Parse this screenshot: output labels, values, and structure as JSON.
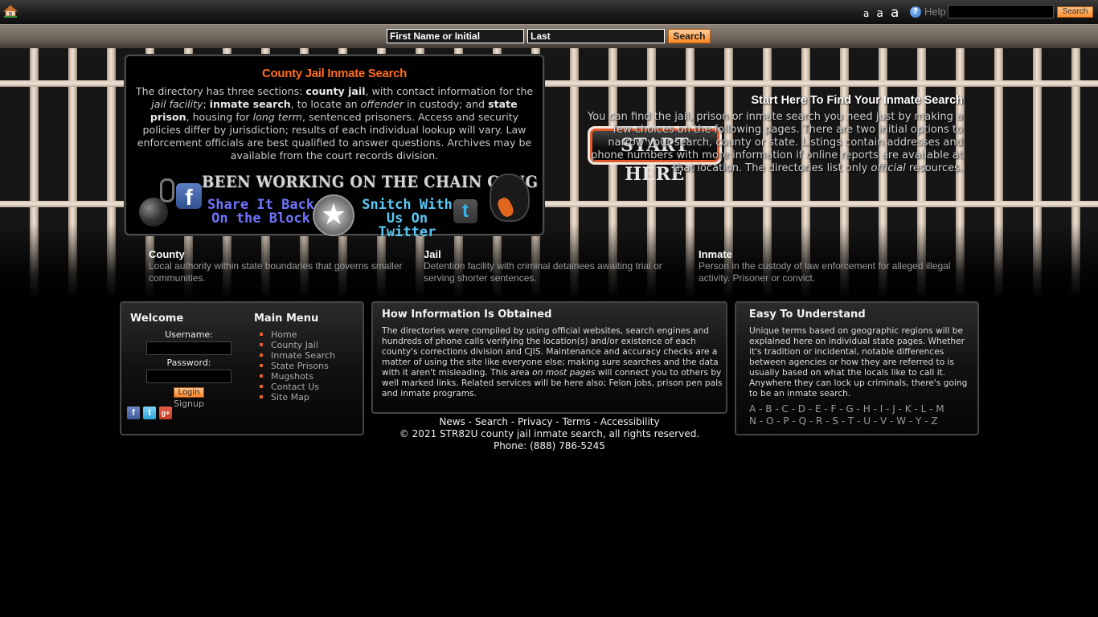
{
  "topbar": {
    "home_icon": "home-icon",
    "font_size_small": "a",
    "font_size_medium": "a",
    "font_size_large": "a",
    "help_icon": "question-circle-icon",
    "help_label": "Help",
    "search_value": "",
    "search_button": "Search"
  },
  "name_search": {
    "first_name_value": "First Name or Initial",
    "last_name_value": "Last",
    "search_button": "Search"
  },
  "info_box": {
    "title": "County Jail Inmate Search",
    "text_parts": {
      "p1": "The directory has three sections: ",
      "b1": "county jail",
      "p2": ", with contact information for the ",
      "i1": "jail facility",
      "p3": "; ",
      "b2": "inmate search",
      "p4": ", to locate an ",
      "i2": "offender",
      "p5": " in custody; and ",
      "b3": "state prison",
      "p6": ", housing for ",
      "i3": "long term",
      "p7": ", sentenced prisoners. Access and security policies differ by jurisdiction; results of each individual lookup will vary. Law enforcement officials are best qualified to answer questions. Archives may be available from the court records division."
    },
    "banner": {
      "title": "BEEN WORKING ON THE CHAIN GANG",
      "share_line1": "Share It Back",
      "share_line2": "On the Block",
      "snitch_line1": "Snitch With",
      "snitch_line2": "Us On Twitter",
      "facebook_glyph": "f",
      "twitter_glyph": "t",
      "badge_glyph": "★"
    }
  },
  "start_here": {
    "button_label": "START HERE",
    "title": "Start Here To Find Your Inmate Search",
    "text_a": "You can find the jail, prison or inmate search you need just by making a few choices on the following pages. There are two initial options to narrow your search, county or state. Listings contain addresses and phone numbers with more information if online reports are available at that location. The directories list only ",
    "text_i": "official",
    "text_b": " resources."
  },
  "terms": [
    {
      "title": "County",
      "text": "Local authority within state boundaries that governs smaller communities."
    },
    {
      "title": "Jail",
      "text": "Detention facility with criminal detainees awaiting trial or serving shorter sentences."
    },
    {
      "title": "Inmate",
      "text": "Person in the custody of law enforcement for alleged illegal activity. Prisoner or convict."
    }
  ],
  "welcome": {
    "title": "Welcome",
    "username_label": "Username:",
    "username_value": "",
    "password_label": "Password:",
    "password_value": "",
    "login_button": "Login",
    "signup_link": "Signup",
    "social": {
      "facebook": "f",
      "twitter": "t",
      "google_plus": "g+"
    }
  },
  "main_menu": {
    "title": "Main Menu",
    "items": [
      "Home",
      "County Jail",
      "Inmate Search",
      "State Prisons",
      "Mugshots",
      "Contact Us",
      "Site Map"
    ]
  },
  "how_info": {
    "title": "How Information Is Obtained",
    "text_a": "The directories were compiled by using official websites, search engines and hundreds of phone calls verifying the location(s) and/or existence of each county's corrections division and CJIS. Maintenance and accuracy checks are a matter of using the site like everyone else; making sure searches and the data with it aren't misleading. This area ",
    "text_i": "on most pages",
    "text_b": " will connect you to others by well marked links. Related services will be here also; Felon jobs, prison pen pals and inmate programs."
  },
  "easy": {
    "title": "Easy To Understand",
    "text": "Unique terms based on geographic regions will be explained here on individual state pages. Whether it's tradition or incidental, notable differences between agencies or how they are referred to is usually based on what the locals like to call it. Anywhere they can lock up criminals, there's going to be an inmate search.",
    "letters_row1": [
      "A",
      "B",
      "C",
      "D",
      "E",
      "F",
      "G",
      "H",
      "I",
      "J",
      "K",
      "L",
      "M"
    ],
    "letters_row2": [
      "N",
      "O",
      "P",
      "Q",
      "R",
      "S",
      "T",
      "U",
      "V",
      "W",
      "Y",
      "Z"
    ]
  },
  "footer": {
    "links": [
      "News",
      "Search",
      "Privacy",
      "Terms",
      "Accessibility"
    ],
    "copyright": "© 2021 STR82U county jail inmate search, all rights reserved.",
    "phone": "Phone: (888) 786-5245"
  }
}
